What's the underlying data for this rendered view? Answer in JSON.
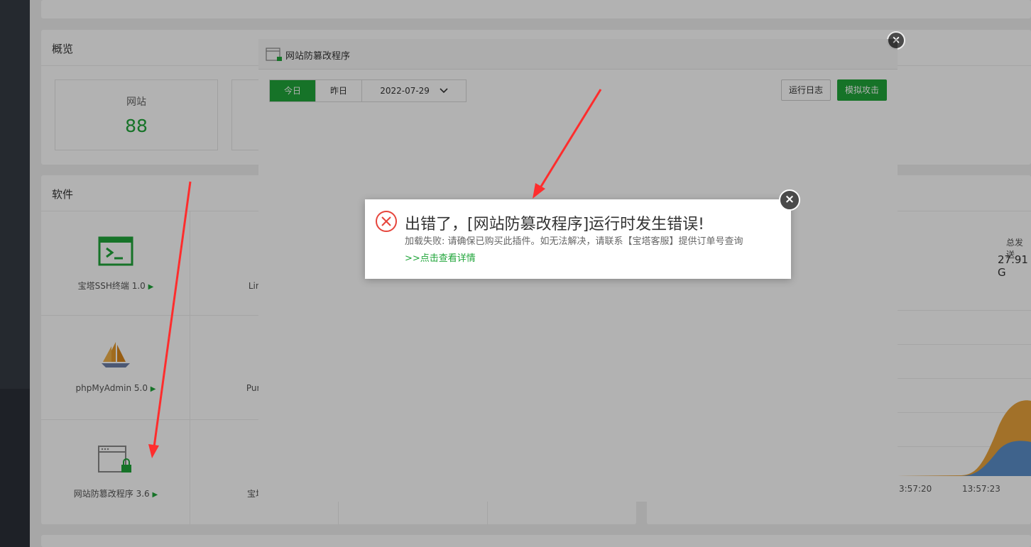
{
  "overview": {
    "title": "概览",
    "stats": [
      {
        "label": "网站",
        "value": "88"
      }
    ]
  },
  "software": {
    "title": "软件",
    "items": [
      {
        "label": "宝塔SSH终端 1.0",
        "icon": "terminal-icon"
      },
      {
        "label": "Linux工",
        "icon": "tools-icon"
      },
      {
        "label": "phpMyAdmin 5.0",
        "icon": "sailboat-icon"
      },
      {
        "label": "Pure-Ftp",
        "icon": "ftp-icon"
      },
      {
        "label": "网站防篡改程序 3.6",
        "icon": "browser-lock-icon"
      },
      {
        "label": "宝塔系统",
        "icon": "shield-icon"
      }
    ]
  },
  "traffic": {
    "total_label": "总发送",
    "total_value": "27.91 G",
    "times": [
      "3:57:20",
      "13:57:23"
    ]
  },
  "modal": {
    "title": "网站防篡改程序",
    "tabs": [
      {
        "label": "今日"
      },
      {
        "label": "昨日"
      }
    ],
    "date_value": "2022-07-29",
    "log_button": "运行日志",
    "attack_button": "模拟攻击"
  },
  "alert": {
    "title": "出错了，[网站防篡改程序]运行时发生错误!",
    "message": "加载失败: 请确保已购买此插件。如无法解决，请联系【宝塔客服】提供订单号查询",
    "link": ">>点击查看详情"
  },
  "colors": {
    "accent": "#20a53a",
    "error": "#e6453c",
    "arrow": "#ff2d2d"
  }
}
